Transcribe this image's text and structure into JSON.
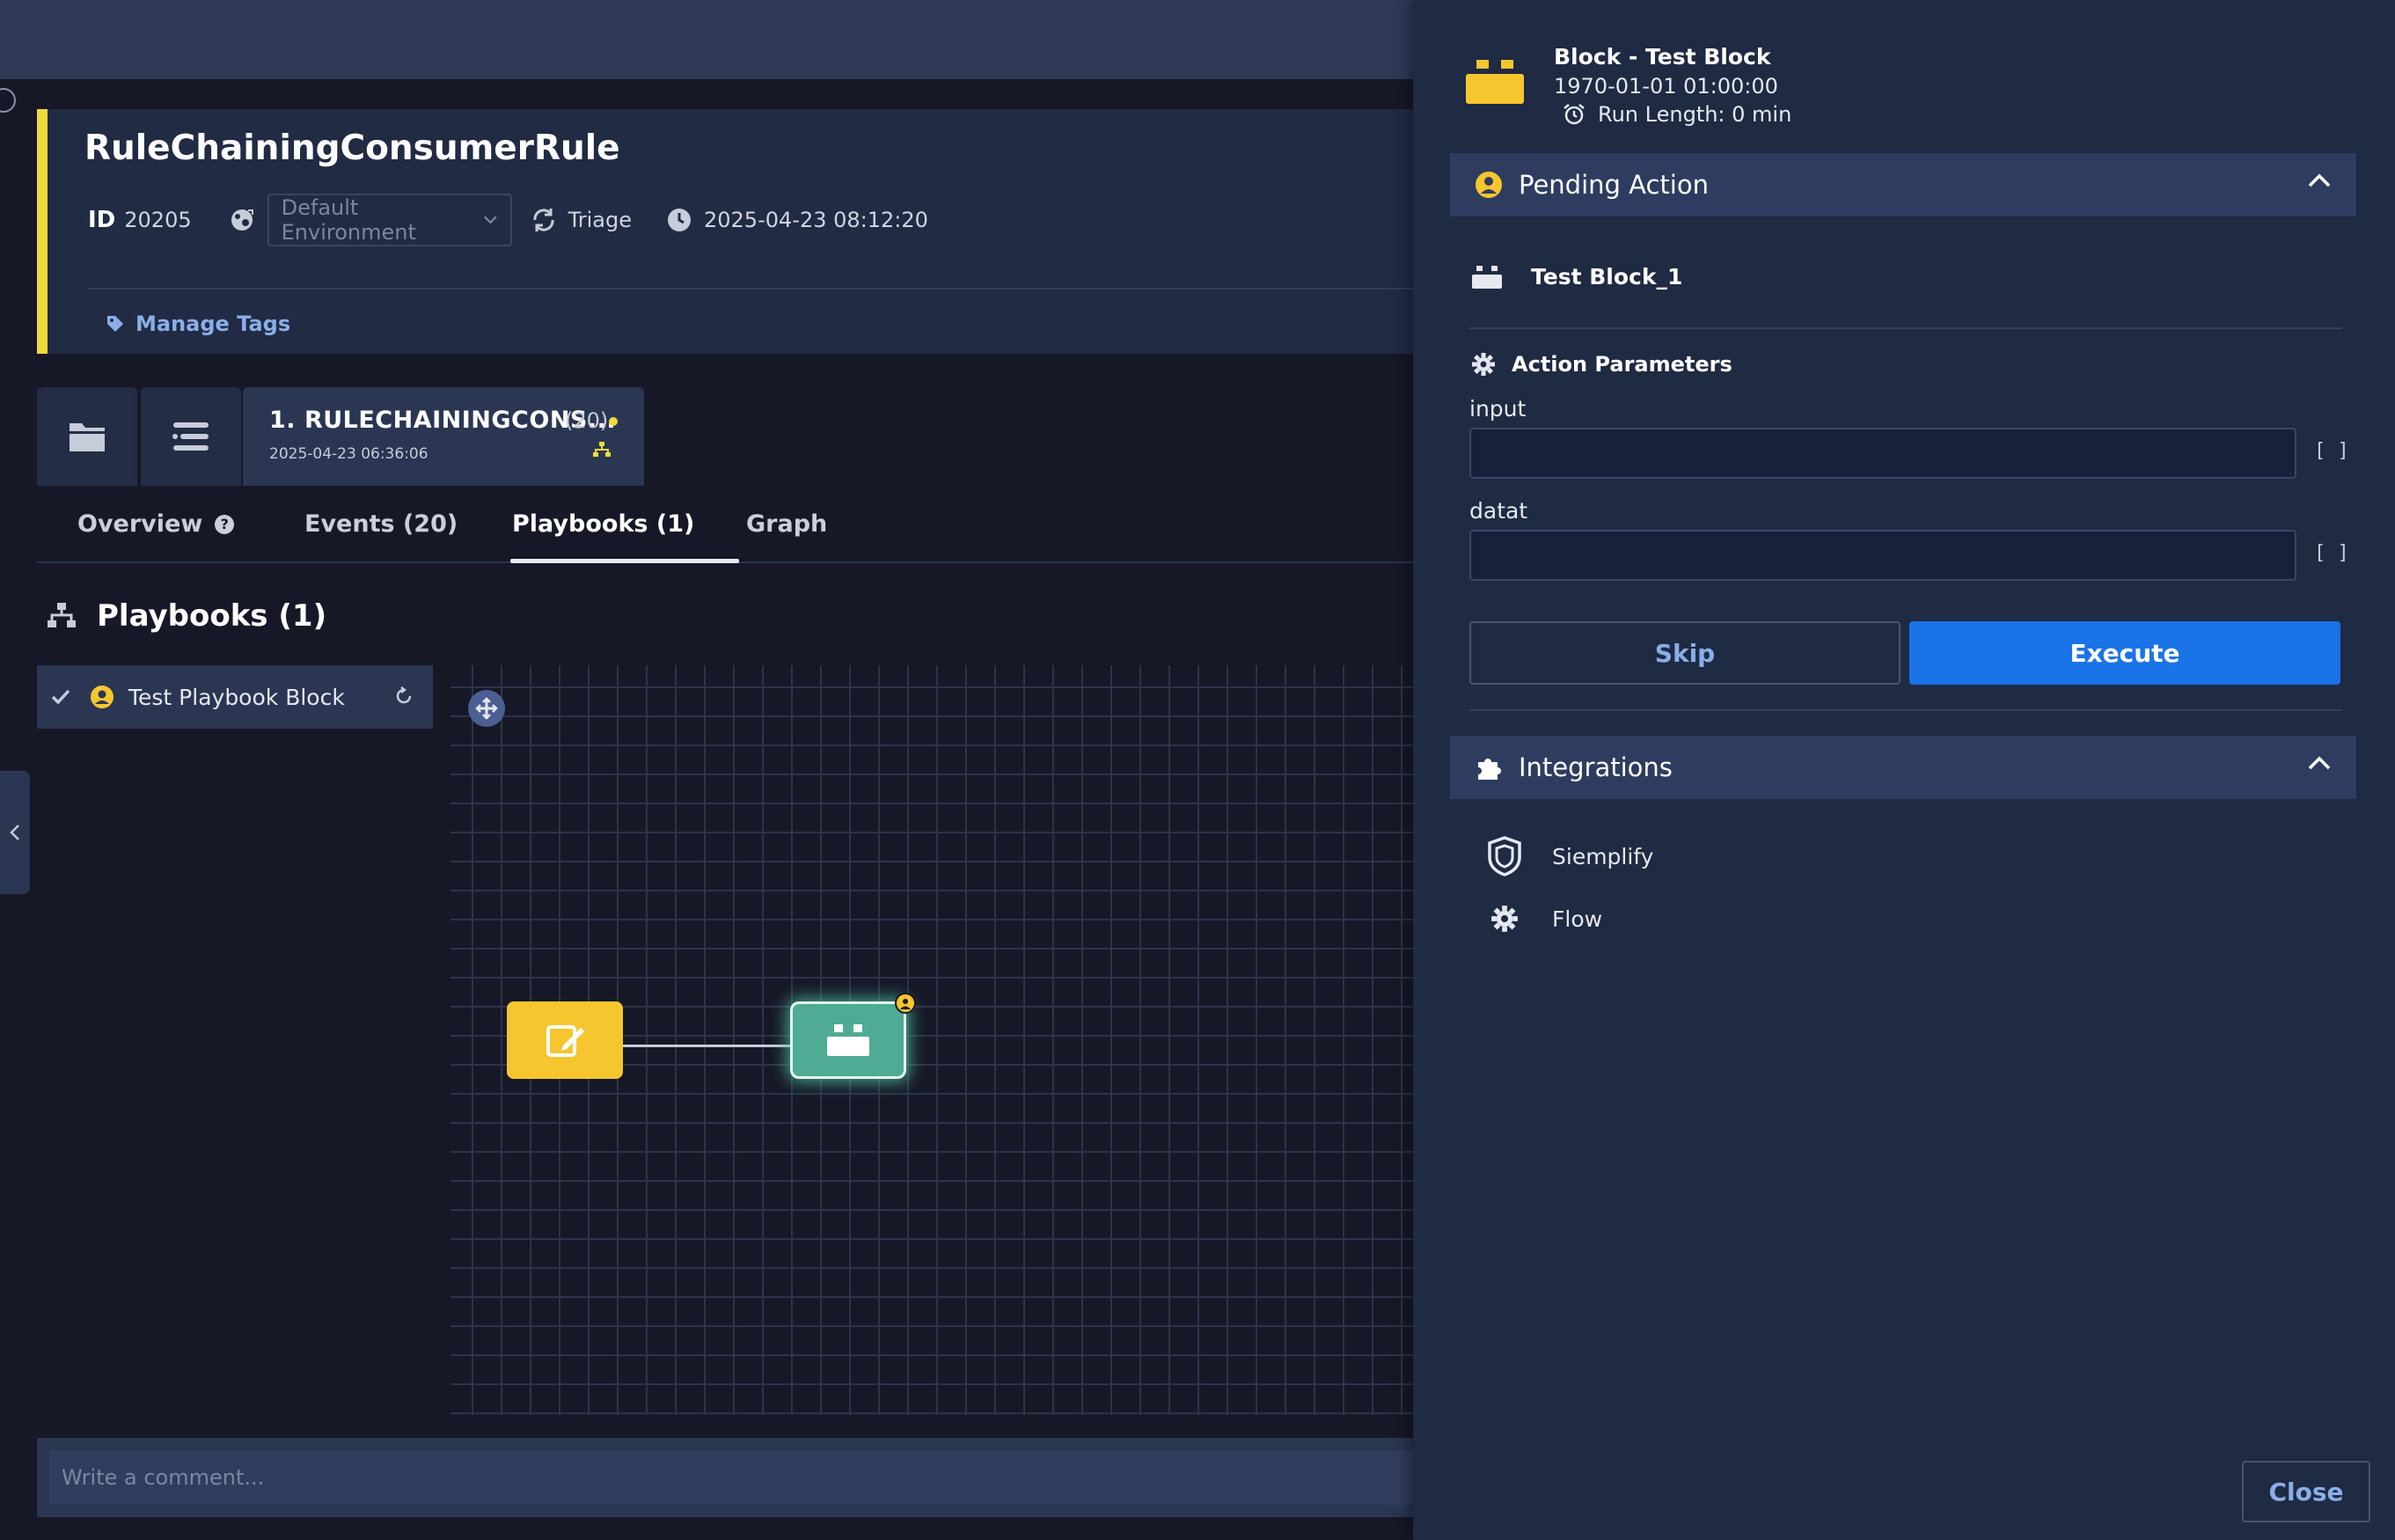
{
  "case": {
    "title": "RuleChainingConsumerRule",
    "id_label": "ID",
    "id_value": "20205",
    "environment": "Default Environment",
    "stage": "Triage",
    "timestamp": "2025-04-23 08:12:20",
    "manage_tags": "Manage Tags"
  },
  "alert_tab": {
    "name": "1. RULECHAININGCONS...",
    "count": "(20)",
    "date": "2025-04-23 06:36:06"
  },
  "tabs": [
    {
      "label": "Overview"
    },
    {
      "label": "Events (20)"
    },
    {
      "label": "Playbooks (1)"
    },
    {
      "label": "Graph"
    }
  ],
  "playbooks": {
    "header": "Playbooks (1)",
    "items": [
      {
        "label": "Test Playbook Block"
      }
    ]
  },
  "comment": {
    "placeholder": "Write a comment..."
  },
  "panel": {
    "title": "Block - Test Block",
    "date": "1970-01-01 01:00:00",
    "run_length": "Run Length: 0 min",
    "pending_action": {
      "header": "Pending Action",
      "block_name": "Test Block_1",
      "params_header": "Action Parameters",
      "fields": [
        {
          "label": "input",
          "value": "",
          "suffix": "[ ]"
        },
        {
          "label": "datat",
          "value": "",
          "suffix": "[ ]"
        }
      ],
      "skip_label": "Skip",
      "execute_label": "Execute"
    },
    "integrations": {
      "header": "Integrations",
      "items": [
        {
          "label": "Siemplify"
        },
        {
          "label": "Flow"
        }
      ]
    },
    "close_label": "Close"
  },
  "colors": {
    "accent_yellow": "#f0da3c",
    "execute_blue": "#1b73e8",
    "block_node": "#4fab93",
    "trigger_node": "#f6c62e"
  }
}
